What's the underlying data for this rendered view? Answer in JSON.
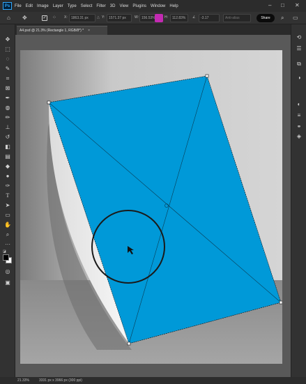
{
  "app": {
    "logo_text": "Ps"
  },
  "menu": {
    "items": [
      "File",
      "Edit",
      "Image",
      "Layer",
      "Type",
      "Select",
      "Filter",
      "3D",
      "View",
      "Plugins",
      "Window",
      "Help"
    ]
  },
  "window_controls": {
    "minimize": "–",
    "maximize": "□",
    "close": "✕"
  },
  "options_bar": {
    "x_label": "X:",
    "x_value": "1863.31 px",
    "y_label": "Y:",
    "y_value": "1571.37 px",
    "w_label": "W:",
    "w_value": "156.53%",
    "h_label": "H:",
    "h_value": "112.83%",
    "angle_label": "∠",
    "angle_value": "-3.17",
    "interp_value": "Anti-alias",
    "share_label": "Share"
  },
  "document_tab": {
    "title": "A4.psd @ 21.3% (Rectangle 1, RGB/8*) *",
    "close": "×"
  },
  "status_bar": {
    "zoom": "21.33%",
    "dimensions": "3331 px x 3966 px (300 ppi)"
  },
  "colors": {
    "rectangle_fill": "#0099d8",
    "menubar_bg": "#2c2c2c",
    "panel_bg": "#323232",
    "canvas_bg": "#595959"
  },
  "icons": {
    "left_tools": [
      "move-icon",
      "marquee-icon",
      "lasso-icon",
      "quick-select-icon",
      "crop-icon",
      "frame-icon",
      "eyedropper-icon",
      "healing-icon",
      "brush-icon",
      "clone-stamp-icon",
      "history-brush-icon",
      "eraser-icon",
      "gradient-icon",
      "blur-icon",
      "dodge-icon",
      "pen-icon",
      "type-icon",
      "path-select-icon",
      "rectangle-icon",
      "hand-icon",
      "zoom-icon",
      "more-tools-icon",
      "default-colors-icon",
      "foreground-background-icon",
      "quick-mask-icon",
      "screen-mode-icon"
    ],
    "right_tools": [
      "history-icon",
      "properties-icon",
      "libraries-icon",
      "adjustments-icon",
      "color-icon",
      "brushes-icon",
      "channels-icon",
      "layers-icon"
    ]
  }
}
